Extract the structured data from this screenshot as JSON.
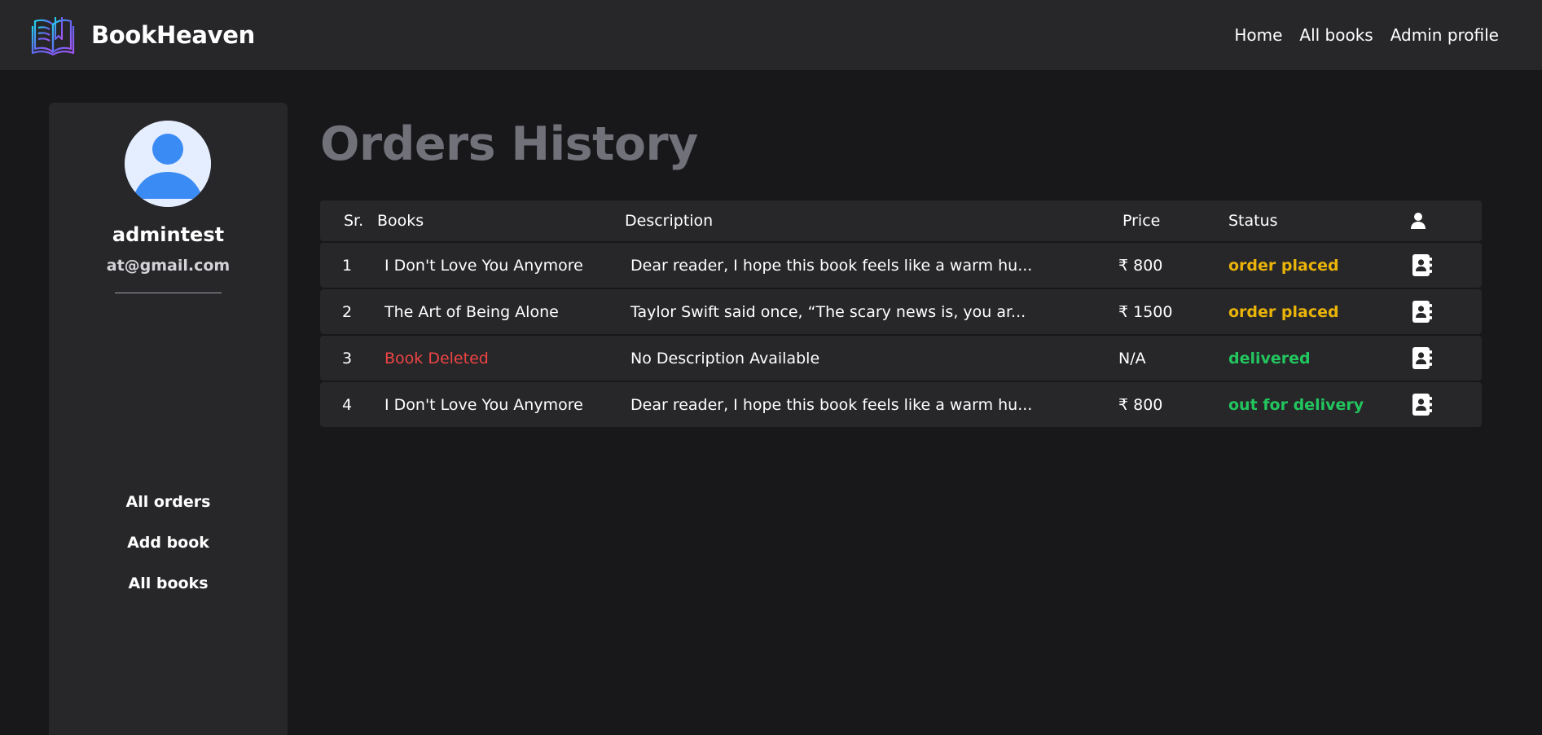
{
  "header": {
    "brand": "BookHeaven",
    "logo_icon": "open-book-icon",
    "nav": [
      {
        "label": "Home"
      },
      {
        "label": "All books"
      },
      {
        "label": "Admin profile"
      }
    ]
  },
  "sidebar": {
    "avatar_icon": "user-avatar-icon",
    "username": "admintest",
    "email": "at@gmail.com",
    "links": [
      {
        "label": "All orders"
      },
      {
        "label": "Add book"
      },
      {
        "label": "All books"
      }
    ]
  },
  "main": {
    "title": "Orders History",
    "table": {
      "headers": {
        "sr": "Sr.",
        "books": "Books",
        "description": "Description",
        "price": "Price",
        "status": "Status",
        "user_icon": "user-icon"
      },
      "rows": [
        {
          "sr": "1",
          "book": "I Don't Love You Anymore",
          "description": "Dear reader, I hope this book feels like a warm hu...",
          "price": "₹ 800",
          "status": "order placed",
          "status_color": "#eab308",
          "action_icon": "address-book-icon"
        },
        {
          "sr": "2",
          "book": "The Art of Being Alone",
          "description": "Taylor Swift said once, “The scary news is, you ar...",
          "price": "₹ 1500",
          "status": "order placed",
          "status_color": "#eab308",
          "action_icon": "address-book-icon"
        },
        {
          "sr": "3",
          "book": "Book Deleted",
          "book_color": "#ef4444",
          "description": "No Description Available",
          "price": "N/A",
          "status": "delivered",
          "status_color": "#22c55e",
          "action_icon": "address-book-icon"
        },
        {
          "sr": "4",
          "book": "I Don't Love You Anymore",
          "description": "Dear reader, I hope this book feels like a warm hu...",
          "price": "₹ 800",
          "status": "out for delivery",
          "status_color": "#22c55e",
          "action_icon": "address-book-icon"
        }
      ]
    }
  },
  "colors": {
    "background": "#18181b",
    "panel": "#27272a",
    "title": "#71717a",
    "order_placed": "#eab308",
    "delivered": "#22c55e",
    "deleted": "#ef4444"
  }
}
